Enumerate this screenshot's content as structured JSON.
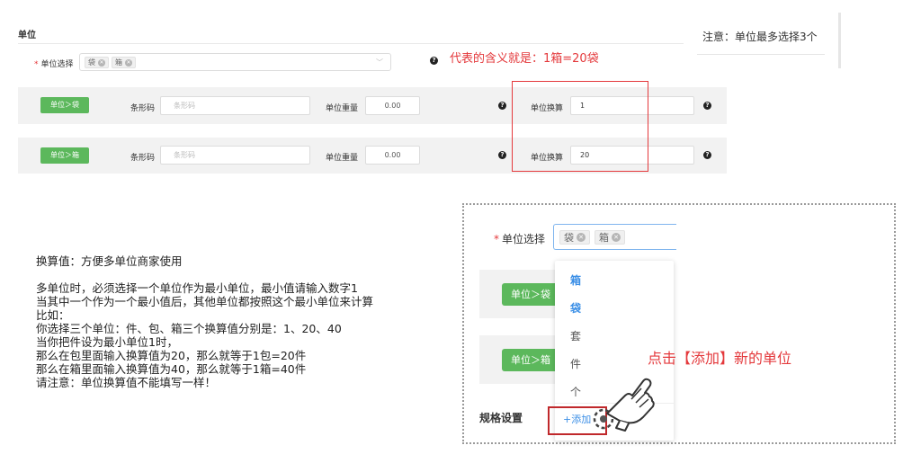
{
  "section_title": "单位",
  "note": "注意：单位最多选择3个",
  "unit_select": {
    "label": "单位选择",
    "required_mark": "*",
    "tags": [
      {
        "label": "袋"
      },
      {
        "label": "箱"
      }
    ]
  },
  "annotation_meaning": "代表的含义就是：1箱=20袋",
  "unit_rows": [
    {
      "unit_button": "单位＞袋",
      "barcode_label": "条形码",
      "barcode_placeholder": "条形码",
      "weight_label": "单位重量",
      "weight_value": "0.00",
      "conversion_label": "单位换算",
      "conversion_value": "1"
    },
    {
      "unit_button": "单位＞箱",
      "barcode_label": "条形码",
      "barcode_placeholder": "条形码",
      "weight_label": "单位重量",
      "weight_value": "0.00",
      "conversion_label": "单位换算",
      "conversion_value": "20"
    }
  ],
  "explanation": [
    "换算值：方便多单位商家使用",
    "",
    "多单位时，必须选择一个单位作为最小单位，最小值请输入数字1",
    "当其中一个作为一个最小值后，其他单位都按照这个最小单位来计算",
    "比如：",
    "你选择三个单位：件、包、箱三个换算值分别是：1、20、40",
    "当你把件设为最小单位1时，",
    "那么在包里面输入换算值为20，那么就等于1包=20件",
    "那么在箱里面输入换算值为40，那么就等于1箱=40件",
    "请注意：单位换算值不能填写一样！"
  ],
  "zoom": {
    "unit_select_label": "单位选择",
    "required_mark": "*",
    "tags": [
      {
        "label": "袋"
      },
      {
        "label": "箱"
      }
    ],
    "row_buttons": [
      "单位＞袋",
      "单位＞箱"
    ],
    "dropdown_options": [
      {
        "label": "箱",
        "selected": true
      },
      {
        "label": "袋",
        "selected": true
      },
      {
        "label": "套",
        "selected": false
      },
      {
        "label": "件",
        "selected": false
      },
      {
        "label": "个",
        "selected": false
      }
    ],
    "add_label": "+添加",
    "spec_settings_label": "规格设置",
    "callout": "点击【添加】新的单位"
  },
  "icons": {
    "help": "question-circle-icon",
    "tag_close": "close-circle-icon",
    "dropdown": "chevron-down-icon",
    "pointer": "pointing-hand-icon"
  },
  "colors": {
    "accent_green": "#5cb85c",
    "annotation_red": "#e4393c",
    "link_blue": "#3a8ee6"
  }
}
